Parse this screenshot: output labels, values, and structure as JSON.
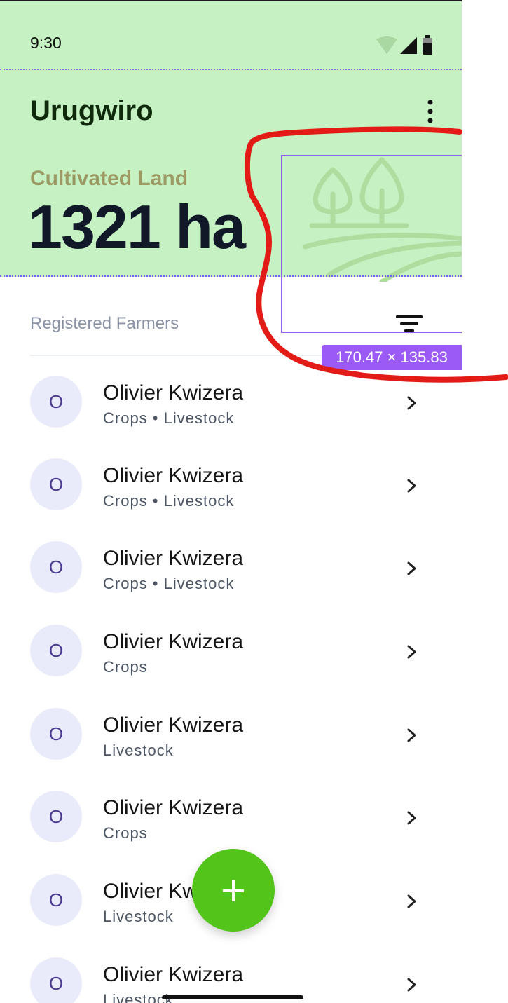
{
  "status_bar": {
    "time": "9:30"
  },
  "header": {
    "app_title": "Urugwiro",
    "cultivated_label": "Cultivated Land",
    "cultivated_value": "1321 ha"
  },
  "section": {
    "label": "Registered Farmers"
  },
  "overlay": {
    "dimensions": "170.47 × 135.83"
  },
  "farmers": [
    {
      "initial": "O",
      "name": "Olivier Kwizera",
      "tags": "Crops • Livestock"
    },
    {
      "initial": "O",
      "name": "Olivier Kwizera",
      "tags": "Crops • Livestock"
    },
    {
      "initial": "O",
      "name": "Olivier Kwizera",
      "tags": "Crops • Livestock"
    },
    {
      "initial": "O",
      "name": "Olivier Kwizera",
      "tags": "Crops"
    },
    {
      "initial": "O",
      "name": "Olivier Kwizera",
      "tags": "Livestock"
    },
    {
      "initial": "O",
      "name": "Olivier Kwizera",
      "tags": "Crops"
    },
    {
      "initial": "O",
      "name": "Olivier Kwizera",
      "tags": "Livestock"
    },
    {
      "initial": "O",
      "name": "Olivier Kwizera",
      "tags": "Livestock"
    }
  ],
  "fab": {
    "icon": "plus-icon",
    "glyph": "+"
  },
  "colors": {
    "header_bg": "#c6f1c2",
    "accent_green": "#52c41a",
    "title_dark_green": "#0e2a0b",
    "label_olive": "#9c9a64",
    "avatar_bg": "#e9ebfb",
    "annotation_purple": "#9b59f5",
    "scribble_red": "#e31b17"
  },
  "icons": {
    "menu": "more-vertical-icon",
    "filter": "filter-icon",
    "chevron": "chevron-right-icon",
    "illustration": "farm-field-icon"
  }
}
